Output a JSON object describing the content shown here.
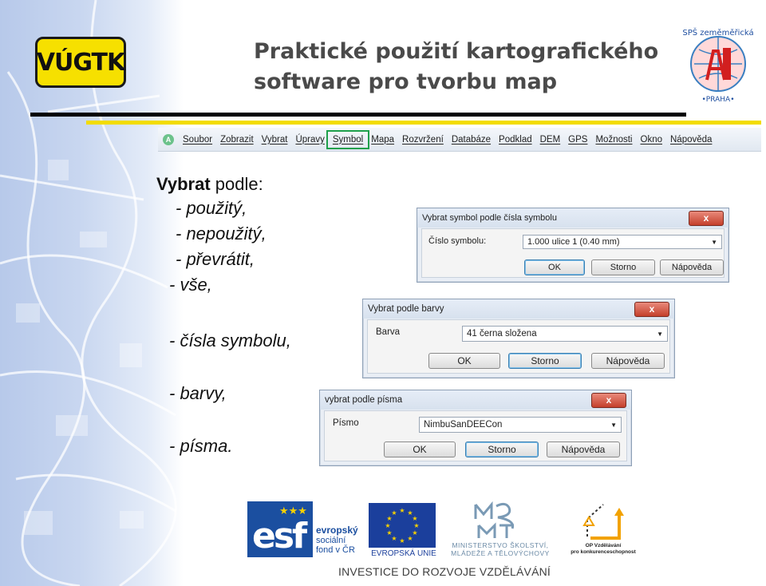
{
  "header": {
    "logo_left_text": "VÚGTK",
    "title_line1": "Praktické použití kartografického",
    "title_line2": "software pro tvorbu map",
    "logo_right_top": "SPŠ zeměměřická",
    "logo_right_bottom": "•PRAHA•"
  },
  "menubar": {
    "app_icon": "A",
    "items": [
      "Soubor",
      "Zobrazit",
      "Vybrat",
      "Úpravy",
      "Symbol",
      "Mapa",
      "Rozvržení",
      "Databáze",
      "Podklad",
      "DEM",
      "GPS",
      "Možnosti",
      "Okno",
      "Nápověda"
    ],
    "highlighted_index": 4,
    "highlight_color": "#1ea04b"
  },
  "options": {
    "heading_bold": "Vybrat",
    "heading_rest": " podle:",
    "items": [
      "- použitý,",
      "- nepoužitý,",
      "- převrátit,",
      "- vše,",
      "- čísla symbolu,",
      "- barvy,",
      "- písma."
    ]
  },
  "dialog_symbol": {
    "title": "Vybrat symbol podle čísla symbolu",
    "close": "x",
    "label": "Číslo symbolu:",
    "value": "1.000 ulice 1 (0.40 mm)",
    "ok": "OK",
    "cancel": "Storno",
    "help": "Nápověda"
  },
  "dialog_color": {
    "title": "Vybrat podle barvy",
    "close": "x",
    "label": "Barva",
    "value": "41 černa složena",
    "ok": "OK",
    "cancel": "Storno",
    "help": "Nápověda"
  },
  "dialog_font": {
    "title": "vybrat podle písma",
    "close": "x",
    "label": "Písmo",
    "value": "NimbuSanDEECon",
    "ok": "OK",
    "cancel": "Storno",
    "help": "Nápověda"
  },
  "footer": {
    "esf_logo": "esf",
    "esf_line1": "evropský",
    "esf_line2": "sociální",
    "esf_line3": "fond v ČR",
    "eu_text": "EVROPSKÁ UNIE",
    "msmt_line1": "MINISTERSTVO ŠKOLSTVÍ,",
    "msmt_line2": "MLÁDEŽE A TĚLOVÝCHOVY",
    "op_line1": "OP Vzdělávání",
    "op_line2": "pro konkurenceschopnost",
    "slogan": "INVESTICE DO ROZVOJE VZDĚLÁVÁNÍ"
  },
  "colors": {
    "title": "#4a4a4a",
    "rule_black": "#000000",
    "rule_yellow": "#f2dc00",
    "esf_blue": "#1b4fa0"
  }
}
